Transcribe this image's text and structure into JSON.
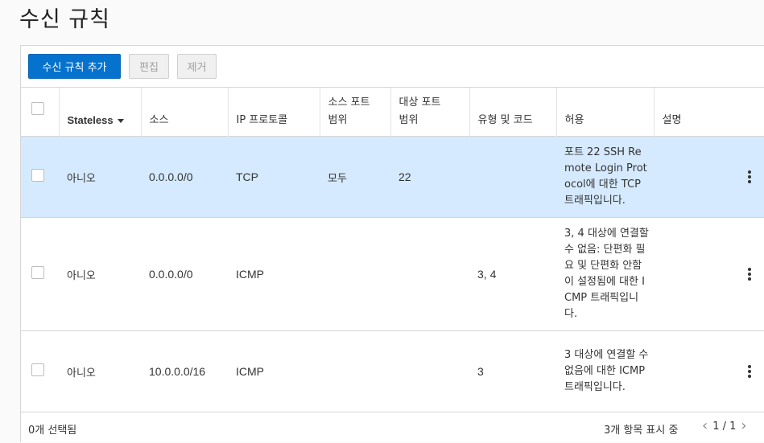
{
  "page_title": "수신 규칙",
  "toolbar": {
    "add_label": "수신 규칙 추가",
    "edit_label": "편집",
    "remove_label": "제거"
  },
  "table": {
    "headers": {
      "stateless": "Stateless",
      "source": "소스",
      "ip_protocol": "IP 프로토콜",
      "source_port": "소스 포트\n범위",
      "dest_port": "대상 포트\n범위",
      "type_code": "유형 및 코드",
      "allows": "허용",
      "description": "설명"
    },
    "rows": [
      {
        "stateless": "아니오",
        "source": "0.0.0.0/0",
        "ip_protocol": "TCP",
        "source_port": "모두",
        "dest_port": "22",
        "type_code": "",
        "allows": "포트 22 SSH Remote Login Protocol에 대한 TCP 트래픽입니다.",
        "description": "",
        "selected": true
      },
      {
        "stateless": "아니오",
        "source": "0.0.0.0/0",
        "ip_protocol": "ICMP",
        "source_port": "",
        "dest_port": "",
        "type_code": "3, 4",
        "allows": "3, 4 대상에 연결할 수 없음: 단편화 필요 및 단편화 안함이 설정됨에 대한 ICMP 트래픽입니다.",
        "description": "",
        "selected": false
      },
      {
        "stateless": "아니오",
        "source": "10.0.0.0/16",
        "ip_protocol": "ICMP",
        "source_port": "",
        "dest_port": "",
        "type_code": "3",
        "allows": "3 대상에 연결할 수 없음에 대한 ICMP 트래픽입니다.",
        "description": "",
        "selected": false
      }
    ]
  },
  "footer": {
    "selected_text": "0개 선택됨",
    "count_text": "3개 항목 표시 중",
    "page_text": "1 / 1"
  },
  "colors": {
    "primary": "#0572ce",
    "selected_row": "#d5eafe"
  }
}
